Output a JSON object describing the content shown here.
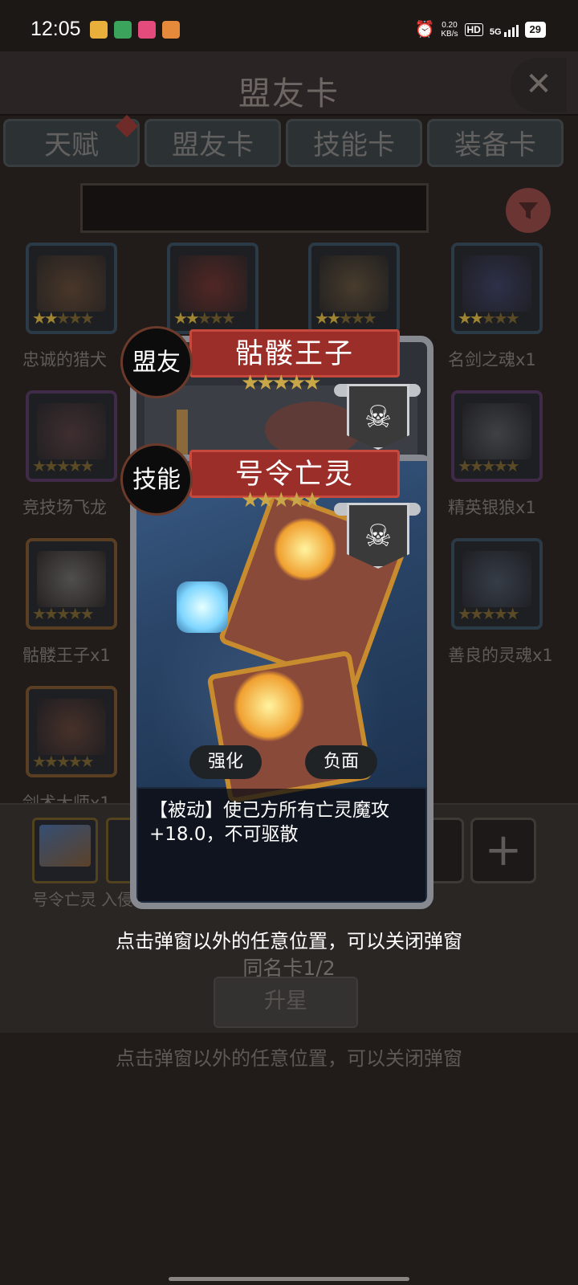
{
  "status_bar": {
    "time": "12:05",
    "net_speed": "0.20",
    "net_unit": "KB/s",
    "hd": "HD",
    "net_type": "5G",
    "battery": "29"
  },
  "header": {
    "title": "盟友卡",
    "close_icon": "✕"
  },
  "tabs": [
    {
      "label": "天赋"
    },
    {
      "label": "盟友卡"
    },
    {
      "label": "技能卡"
    },
    {
      "label": "装备卡"
    }
  ],
  "grid": {
    "cards": [
      {
        "label": "忠诚的猎犬"
      },
      {
        "label": ""
      },
      {
        "label": ""
      },
      {
        "label": "名剑之魂x1"
      },
      {
        "label": "竞技场飞龙"
      },
      {
        "label": "精英银狼x1"
      },
      {
        "label": "骷髅王子x1"
      },
      {
        "label": "善良的灵魂x1"
      },
      {
        "label": "剑术大师x1"
      }
    ]
  },
  "bottom": {
    "cards": [
      {
        "label": "号令亡灵"
      },
      {
        "label": "入侵"
      }
    ],
    "plus_icon": "+",
    "same_name_count": "同名卡1/2",
    "upgrade_label": "升星",
    "hint": "点击弹窗以外的任意位置，可以关闭弹窗"
  },
  "overlay": {
    "ally": {
      "badge": "盟友",
      "name": "骷髅王子",
      "stars": "★★★★★",
      "class_icon": "skull-icon"
    },
    "skill": {
      "badge": "技能",
      "name": "号令亡灵",
      "stars": "★★★★★",
      "class_icon": "skull-crossbones-icon",
      "tags": [
        "强化",
        "负面"
      ],
      "description": "【被动】使己方所有亡灵魔攻+18.0，不可驱散"
    },
    "hint": "点击弹窗以外的任意位置，可以关闭弹窗"
  },
  "colors": {
    "ribbon_red": "#9b2e28",
    "badge_border": "#6b3a2b",
    "background": "#211b19"
  }
}
